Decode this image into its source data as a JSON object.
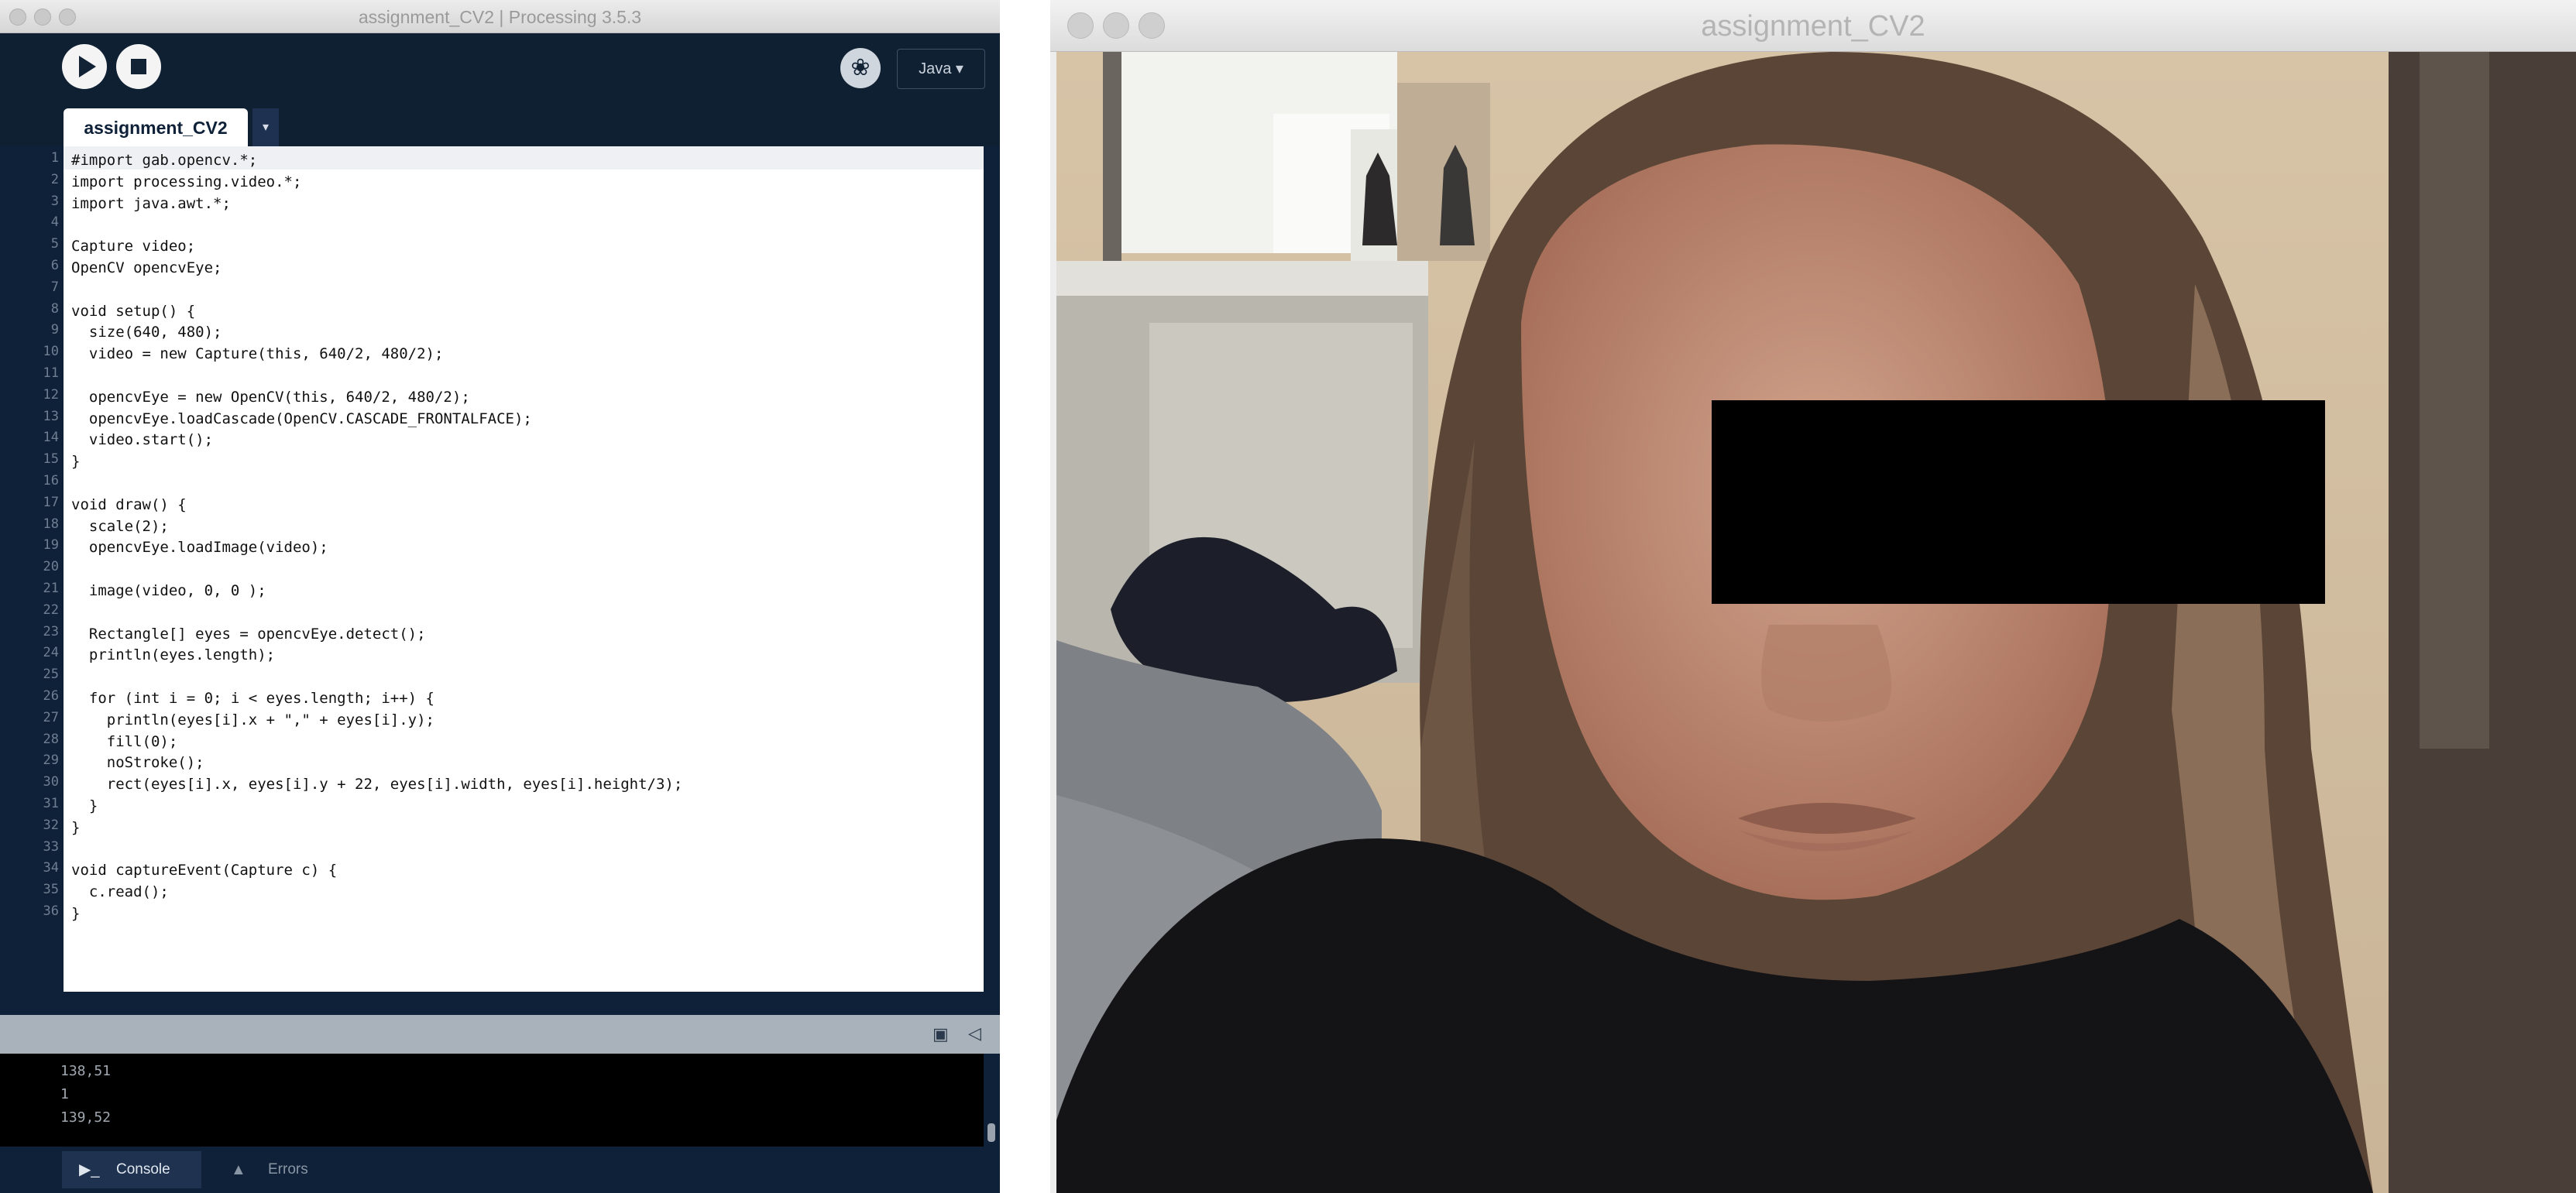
{
  "ide": {
    "window_title": "assignment_CV2 | Processing 3.5.3",
    "mode": "Java ▾",
    "tab_name": "assignment_CV2",
    "tab_menu": "▾",
    "code_lines": [
      "#import gab.opencv.*;",
      "import processing.video.*;",
      "import java.awt.*;",
      "",
      "Capture video;",
      "OpenCV opencvEye;",
      "",
      "void setup() {",
      "  size(640, 480);",
      "  video = new Capture(this, 640/2, 480/2);",
      "",
      "  opencvEye = new OpenCV(this, 640/2, 480/2);",
      "  opencvEye.loadCascade(OpenCV.CASCADE_FRONTALFACE);",
      "  video.start();",
      "}",
      "",
      "void draw() {",
      "  scale(2);",
      "  opencvEye.loadImage(video);",
      "",
      "  image(video, 0, 0 );",
      "",
      "  Rectangle[] eyes = opencvEye.detect();",
      "  println(eyes.length);",
      "",
      "  for (int i = 0; i < eyes.length; i++) {",
      "    println(eyes[i].x + \",\" + eyes[i].y);",
      "    fill(0);",
      "    noStroke();",
      "    rect(eyes[i].x, eyes[i].y + 22, eyes[i].width, eyes[i].height/3);",
      "  }",
      "}",
      "",
      "void captureEvent(Capture c) {",
      "  c.read();",
      "}"
    ],
    "line_numbers": [
      "1",
      "2",
      "3",
      "4",
      "5",
      "6",
      "7",
      "8",
      "9",
      "10",
      "11",
      "12",
      "13",
      "14",
      "15",
      "16",
      "17",
      "18",
      "19",
      "20",
      "21",
      "22",
      "23",
      "24",
      "25",
      "26",
      "27",
      "28",
      "29",
      "30",
      "31",
      "32",
      "33",
      "34",
      "35",
      "36"
    ],
    "console_lines": [
      "138,51",
      "1",
      "139,52"
    ],
    "console_tab": "Console",
    "errors_tab": "Errors"
  },
  "sketch": {
    "window_title": "assignment_CV2"
  },
  "icons": {
    "run": "play-icon",
    "stop": "stop-icon",
    "mode": "debugger-icon",
    "console": "console-icon",
    "errors": "warning-icon"
  }
}
